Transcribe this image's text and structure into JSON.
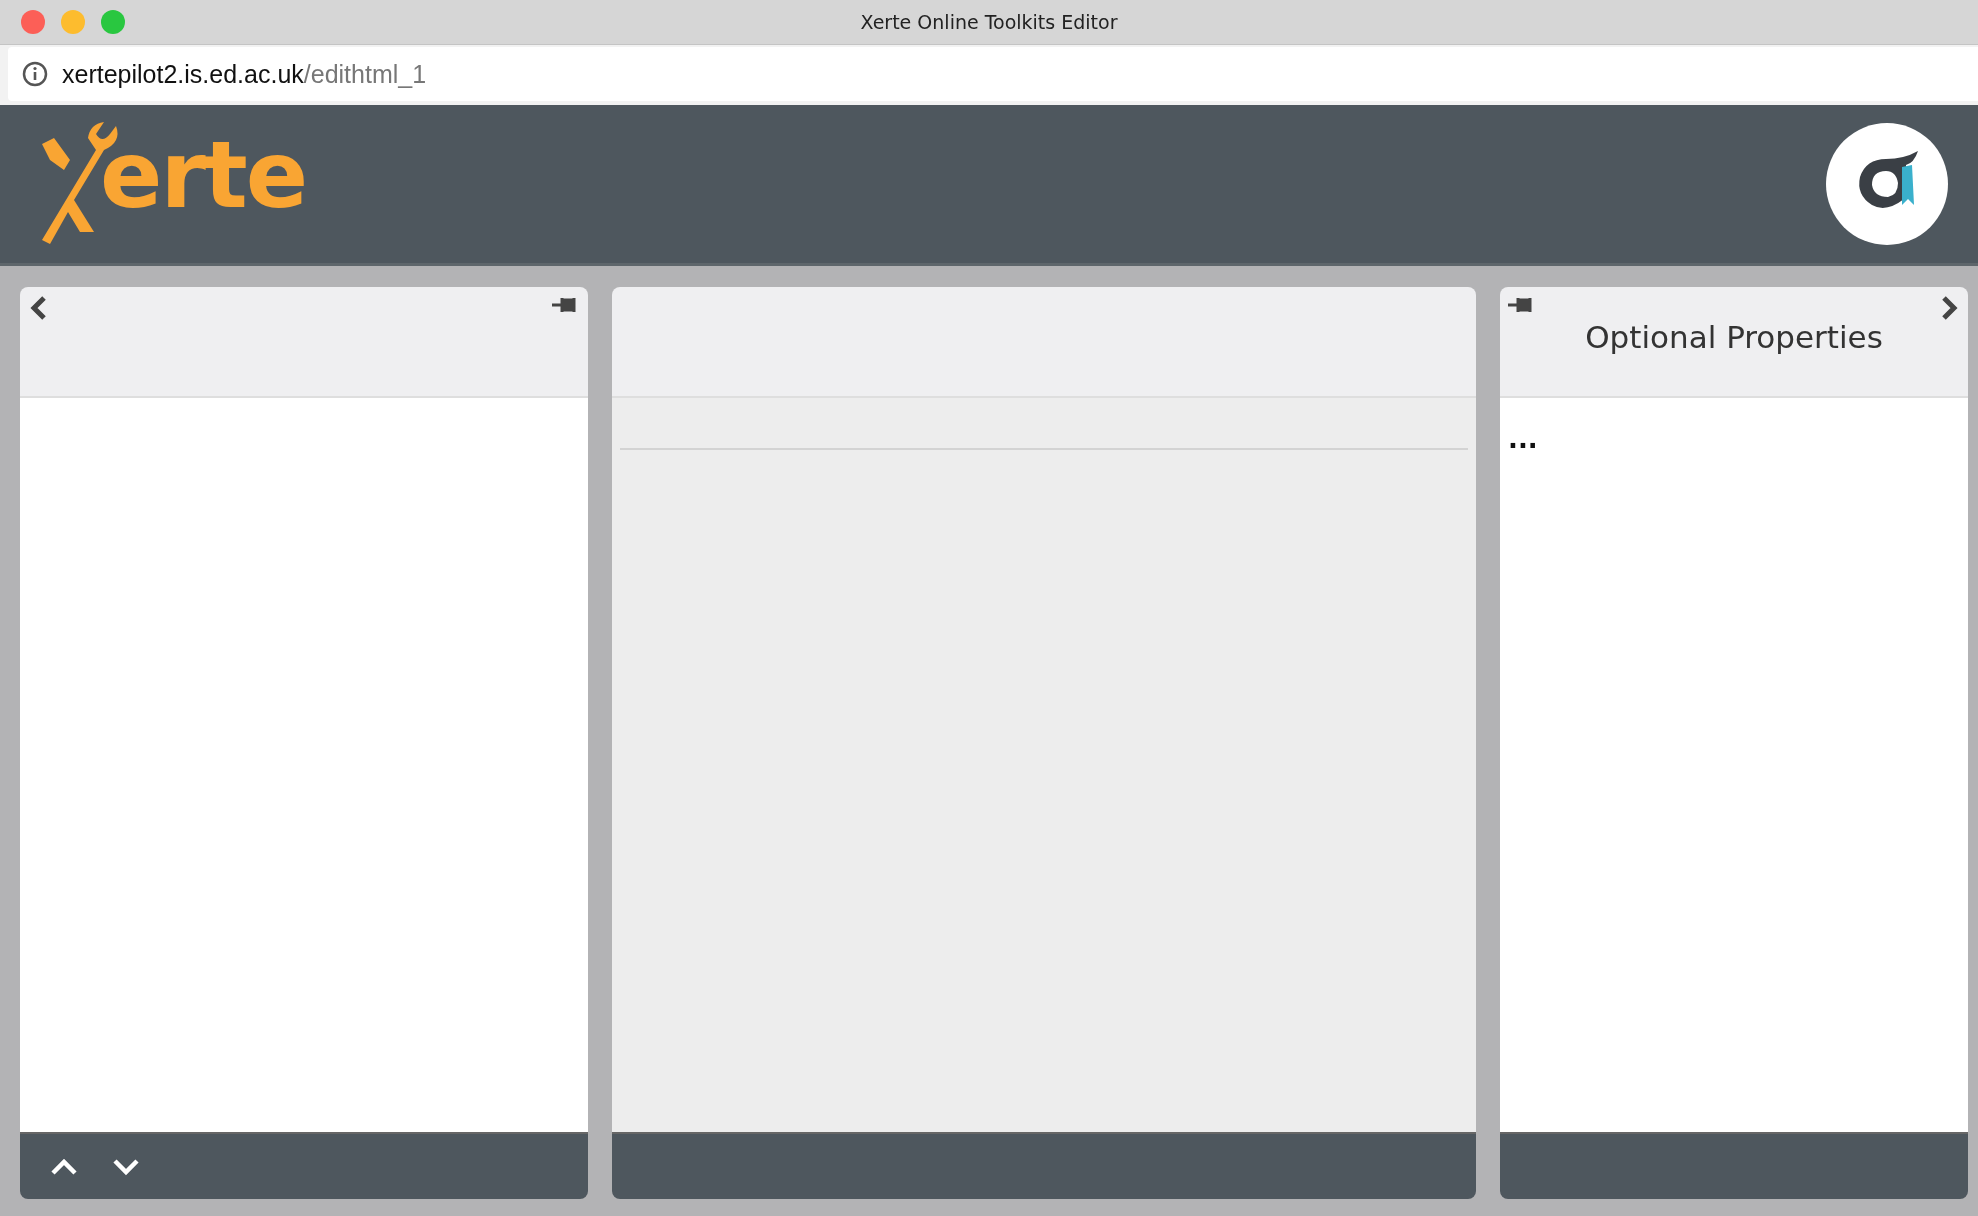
{
  "window": {
    "title": "Xerte Online Toolkits Editor"
  },
  "address_bar": {
    "host": "xertepilot2.is.ed.ac.uk",
    "path": "/edithtml_1"
  },
  "header": {
    "logo_text": "erte"
  },
  "panels": [
    {
      "kind": "left"
    },
    {
      "kind": "middle"
    },
    {
      "kind": "right",
      "title": "Optional Properties",
      "body": "..."
    }
  ]
}
